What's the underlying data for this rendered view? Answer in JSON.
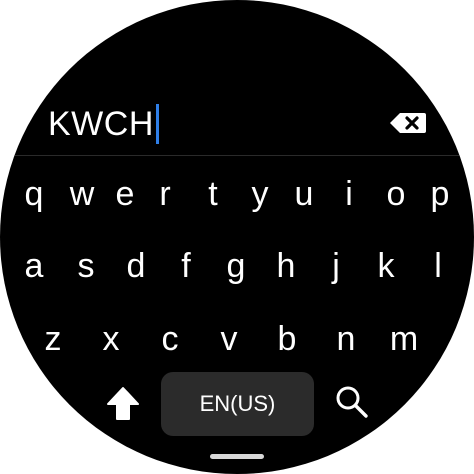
{
  "input": {
    "text": "KWCH",
    "backspace_icon": "backspace-icon"
  },
  "keyboard": {
    "row1": [
      "q",
      "w",
      "e",
      "r",
      "t",
      "y",
      "u",
      "i",
      "o",
      "p"
    ],
    "row2": [
      "a",
      "s",
      "d",
      "f",
      "g",
      "h",
      "j",
      "k",
      "l"
    ],
    "row3": [
      "z",
      "x",
      "c",
      "v",
      "b",
      "n",
      "m"
    ],
    "shift_icon": "shift-arrow-icon",
    "language_label": "EN(US)",
    "search_icon": "search-icon"
  },
  "colors": {
    "background": "#000000",
    "caret": "#2f7fe8",
    "key_text": "#ffffff",
    "language_key_bg": "#2b2b2b"
  }
}
